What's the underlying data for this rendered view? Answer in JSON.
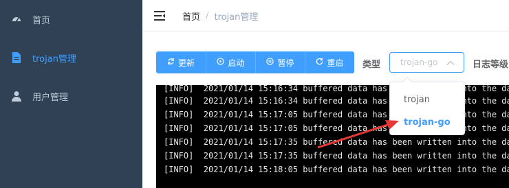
{
  "sidebar": {
    "items": [
      {
        "label": "首页",
        "icon": "dashboard-icon"
      },
      {
        "label": "trojan管理",
        "icon": "document-icon",
        "active": true
      },
      {
        "label": "用户管理",
        "icon": "user-icon"
      }
    ]
  },
  "header": {
    "breadcrumb_home": "首页",
    "breadcrumb_sep": "/",
    "breadcrumb_current": "trojan管理"
  },
  "toolbar": {
    "buttons": [
      {
        "label": "更新",
        "icon": "refresh-icon"
      },
      {
        "label": "启动",
        "icon": "play-icon"
      },
      {
        "label": "暂停",
        "icon": "pause-icon"
      },
      {
        "label": "重启",
        "icon": "restart-icon"
      }
    ],
    "type_label": "类型",
    "type_placeholder": "trojan-go",
    "log_level_label": "日志等级"
  },
  "dropdown": {
    "options": [
      {
        "label": "trojan",
        "selected": false
      },
      {
        "label": "trojan-go",
        "selected": true
      }
    ]
  },
  "log": {
    "lines": [
      "[INFO]  2021/01/14 15:16:34 buffered data has been written into the data",
      "[INFO]  2021/01/14 15:16:34 buffered data has been written into the data",
      "[INFO]  2021/01/14 15:17:05 buffered data has been written into the data",
      "[INFO]  2021/01/14 15:17:05 buffered data has been written into the data",
      "[INFO]  2021/01/14 15:17:35 buffered data has been written into the data",
      "[INFO]  2021/01/14 15:17:35 buffered data has been written into the data",
      "[INFO]  2021/01/14 15:18:05 buffered data has been written into the data"
    ]
  },
  "colors": {
    "sidebar_bg": "#304156",
    "accent": "#409eff",
    "annotation_arrow": "#e53935"
  }
}
